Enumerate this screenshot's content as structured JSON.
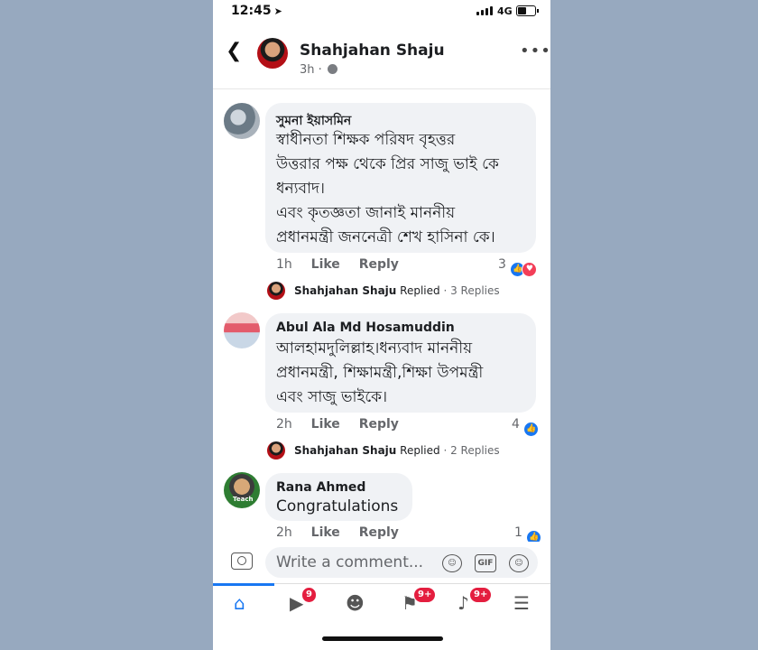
{
  "status_bar": {
    "time": "12:45",
    "network": "4G"
  },
  "header": {
    "name": "Shahjahan Shaju",
    "meta": "3h ·"
  },
  "comments": [
    {
      "author": "সুমনা ইয়াসমিন",
      "lines": [
        "স্বাধীনতা শিক্ষক পরিষদ বৃহত্তর",
        "উত্তরার পক্ষ থেকে প্রির সাজু ভাই কে",
        "ধন্যবাদ।",
        "এবং কৃতজ্ঞতা জানাই মাননীয়",
        "প্রধানমন্ত্রী জননেত্রী শেখ হাসিনা কে।"
      ],
      "time": "1h",
      "like": "Like",
      "reply": "Reply",
      "reaction_count": "3",
      "replied": {
        "name": "Shahjahan Shaju",
        "text": "Replied",
        "count": "· 3 Replies"
      }
    },
    {
      "author": "Abul Ala Md Hosamuddin",
      "lines": [
        "আলহামদুলিল্লাহ।ধন্যবাদ মাননীয়",
        "প্রধানমন্ত্রী, শিক্ষামন্ত্রী,শিক্ষা উপমন্ত্রী",
        "এবং সাজু ভাইকে।"
      ],
      "time": "2h",
      "like": "Like",
      "reply": "Reply",
      "reaction_count": "4",
      "replied": {
        "name": "Shahjahan Shaju",
        "text": "Replied",
        "count": "· 2 Replies"
      }
    },
    {
      "author": "Rana Ahmed",
      "lines": [
        "Congratulations"
      ],
      "avatar_text": "Teach",
      "time": "2h",
      "like": "Like",
      "reply": "Reply",
      "reaction_count": "1"
    }
  ],
  "composer": {
    "placeholder": "Write a comment...",
    "gif": "GIF"
  },
  "tabs": [
    {
      "icon": "home-icon"
    },
    {
      "icon": "watch-icon",
      "badge": "9"
    },
    {
      "icon": "groups-icon"
    },
    {
      "icon": "flag-icon",
      "badge": "9+"
    },
    {
      "icon": "bell-icon",
      "badge": "9+"
    },
    {
      "icon": "menu-icon"
    }
  ],
  "colors": {
    "accent": "#1877f2",
    "badge": "#e41e3f",
    "bubble": "#f0f2f5",
    "love": "#f33e58"
  }
}
